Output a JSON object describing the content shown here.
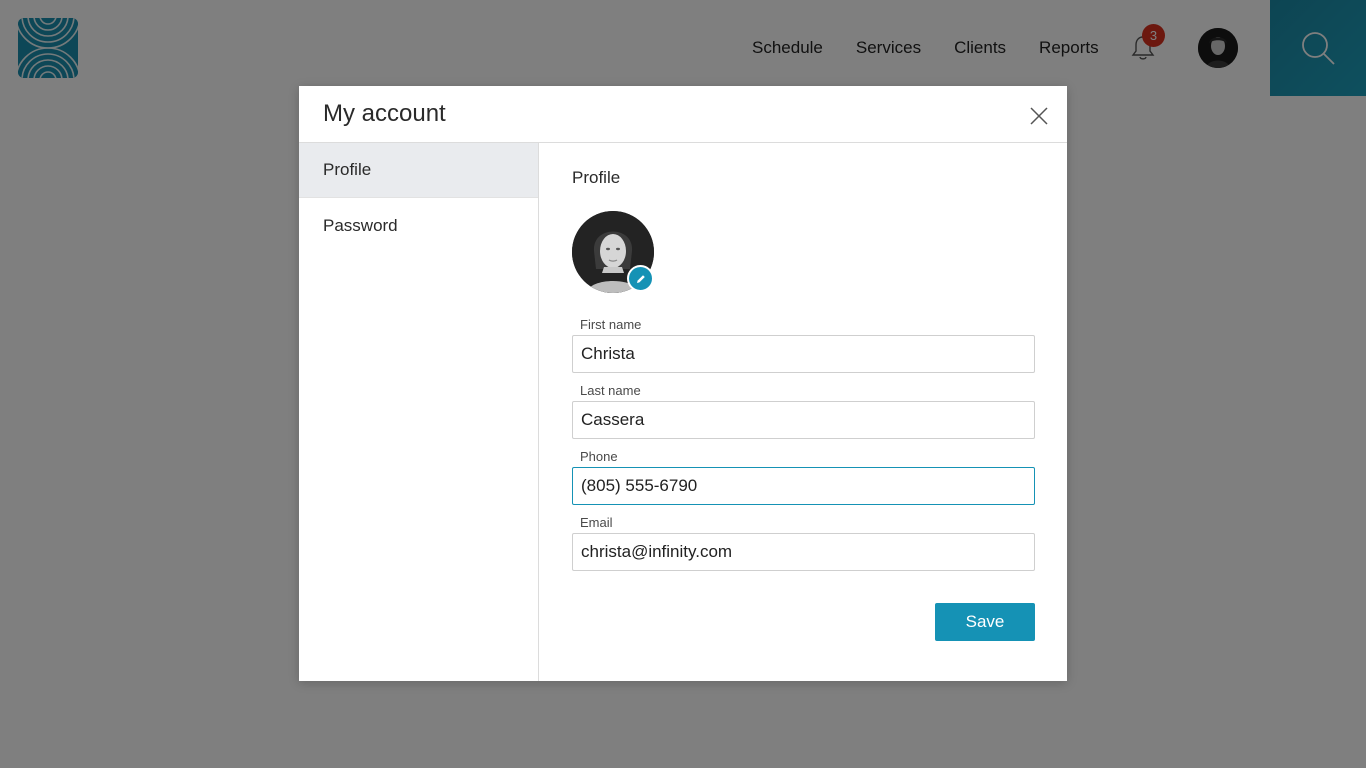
{
  "header": {
    "nav": [
      "Schedule",
      "Services",
      "Clients",
      "Reports"
    ],
    "notification_count": "3",
    "icons": {
      "logo": "brand-arcs-logo",
      "notifications": "bell-icon",
      "avatar": "user-avatar",
      "search": "search-icon"
    },
    "colors": {
      "brand": "#1b8fae",
      "badge": "#d9301f"
    }
  },
  "modal": {
    "title": "My account",
    "close_icon": "close-icon",
    "sidebar": {
      "items": [
        {
          "label": "Profile",
          "active": true
        },
        {
          "label": "Password",
          "active": false
        }
      ]
    },
    "profile": {
      "section_title": "Profile",
      "photo_edit_icon": "pencil-icon",
      "fields": {
        "first_name": {
          "label": "First name",
          "value": "Christa"
        },
        "last_name": {
          "label": "Last name",
          "value": "Cassera"
        },
        "phone": {
          "label": "Phone",
          "value": "(805) 555-6790"
        },
        "email": {
          "label": "Email",
          "value": "christa@infinity.com"
        }
      },
      "save_label": "Save"
    },
    "colors": {
      "accent": "#1592b5"
    }
  }
}
